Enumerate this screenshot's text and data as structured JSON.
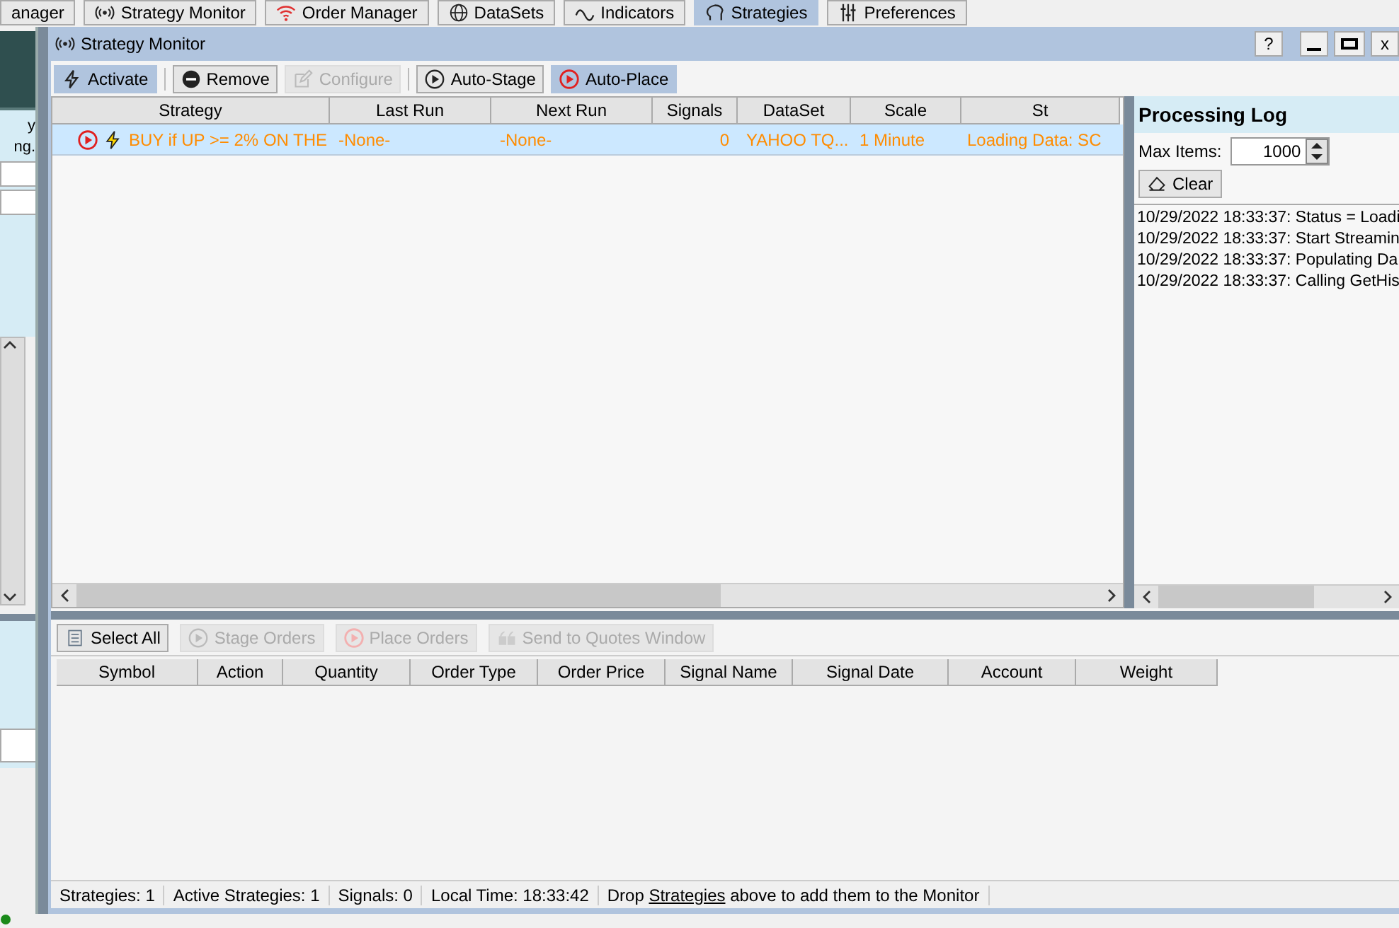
{
  "nav_tabs": [
    {
      "label": "anager",
      "selected": false
    },
    {
      "label": "Strategy Monitor",
      "selected": false
    },
    {
      "label": "Order Manager",
      "selected": false
    },
    {
      "label": "DataSets",
      "selected": false
    },
    {
      "label": "Indicators",
      "selected": false
    },
    {
      "label": "Strategies",
      "selected": true
    },
    {
      "label": "Preferences",
      "selected": false
    }
  ],
  "side_panel": {
    "note_lines": [
      "y",
      "ng."
    ]
  },
  "window": {
    "title": "Strategy Monitor",
    "help": "?",
    "close": "x"
  },
  "toolbar": [
    {
      "label": "Activate",
      "selected": true,
      "disabled": false
    },
    {
      "label": "Remove",
      "selected": false,
      "disabled": false
    },
    {
      "label": "Configure",
      "selected": false,
      "disabled": true
    },
    {
      "label": "Auto-Stage",
      "selected": false,
      "disabled": false
    },
    {
      "label": "Auto-Place",
      "selected": true,
      "disabled": false
    }
  ],
  "strategy_table": {
    "columns": [
      "Strategy",
      "Last Run",
      "Next Run",
      "Signals",
      "DataSet",
      "Scale",
      "St"
    ],
    "rows": [
      {
        "selected": true,
        "strategy": "BUY if UP >= 2% ON THE",
        "last_run": "-None-",
        "next_run": "-None-",
        "signals": "0",
        "dataset": "YAHOO TQ...",
        "scale": "1 Minute",
        "status": "Loading Data: SC"
      }
    ]
  },
  "processing_log": {
    "title": "Processing Log",
    "max_items_label": "Max Items:",
    "max_items": "1000",
    "clear": "Clear",
    "entries": [
      "10/29/2022 18:33:37: Status = Loadi",
      "10/29/2022 18:33:37: Start Streamin",
      "10/29/2022 18:33:37: Populating Da",
      "10/29/2022 18:33:37: Calling GetHis"
    ]
  },
  "orders_toolbar": [
    {
      "label": "Select All",
      "disabled": false
    },
    {
      "label": "Stage Orders",
      "disabled": true
    },
    {
      "label": "Place Orders",
      "disabled": true
    },
    {
      "label": "Send to Quotes Window",
      "disabled": true
    }
  ],
  "orders_table": {
    "columns": [
      "Symbol",
      "Action",
      "Quantity",
      "Order Type",
      "Order Price",
      "Signal Name",
      "Signal Date",
      "Account",
      "Weight"
    ]
  },
  "status_bar": [
    {
      "text": "Strategies: 1"
    },
    {
      "text": "Active Strategies: 1"
    },
    {
      "text": "Signals: 0"
    },
    {
      "text": "Local Time: 18:33:42"
    },
    {
      "text": "Drop ",
      "link": "Strategies",
      "after": " above to add them to the Monitor"
    }
  ]
}
